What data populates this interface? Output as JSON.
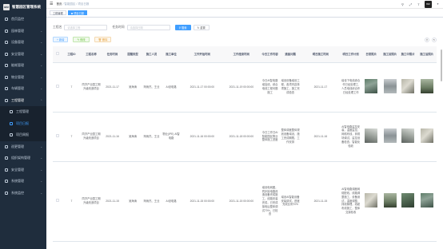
{
  "app": {
    "logo_mark": "BIM",
    "title": "智慧园区管理系统"
  },
  "sidebar": {
    "items": [
      {
        "label": "首页监控"
      },
      {
        "label": "园林管理"
      },
      {
        "label": "设备管理"
      },
      {
        "label": "安全管理"
      },
      {
        "label": "能耗管理"
      },
      {
        "label": "物业管理"
      },
      {
        "label": "车辆管理"
      },
      {
        "label": "工程管理"
      }
    ],
    "subitems": [
      {
        "label": "工程管理"
      },
      {
        "label": "项目日报"
      },
      {
        "label": "项目周报"
      }
    ],
    "items_after": [
      {
        "label": "巡更管理"
      },
      {
        "label": "组织架构管理"
      },
      {
        "label": "安全管理"
      },
      {
        "label": "系统管理"
      },
      {
        "label": "系统监控"
      }
    ]
  },
  "header": {
    "breadcrumb": [
      "首页",
      "智能园区",
      "项目日报"
    ],
    "avatar_text": "BIM"
  },
  "tags": [
    {
      "label": "工程管理"
    },
    {
      "label": "项目日报"
    }
  ],
  "search": {
    "project_label": "工程名",
    "project_placeholder": "请选择工程",
    "date_label": "任务时间",
    "date_placeholder": "请选择日期",
    "search_btn": "搜索",
    "reset_btn": "重置"
  },
  "actions": {
    "add": "新增",
    "edit": "修改",
    "delete": "删除"
  },
  "table": {
    "headers": [
      "工程ID",
      "工程名称",
      "任务时间",
      "提醒类型",
      "施工人员",
      "施工单位",
      "工作开始时间",
      "工作结束时间",
      "今日工作内容",
      "遗留问题",
      "明日施工时间",
      "明日工作计划",
      "日常照片",
      "施工前照片",
      "施工中照片",
      "施工后照片"
    ],
    "rows": [
      {
        "id": "7",
        "name": "同济产业园工期升级改造项目",
        "date": "2021-11-17",
        "type": "吴海涛",
        "workers": "阿雨杰、王业",
        "unit": "AI设电路",
        "start": "2021-11-17 00:00:00",
        "end": "2021-11-19 00:00:00",
        "content": "今日AI智电路增加线，综合电线工程问题施工",
        "issue": "增设设备增设工程，各项内容事项施工，施工完成检查",
        "next": "2021-11-17",
        "plan": "增设下电线综合作已经处理工, 人员电线综合作已经处理工作"
      },
      {
        "id": "7",
        "name": "同济产业园工期升级改造项目",
        "date": "2021-11-16",
        "type": "吴海涛",
        "workers": "阿雨杰、王业",
        "unit": "物业(IPE) AI智电路",
        "start": "2021-11-16 00:00:00",
        "end": "2021-11-18 00:00:00",
        "content": "今日工作日AI智能园区物业整体施工进度",
        "issue": "整体调度整体规划设备增设，施工完成期限，工作安排",
        "next": "2021-11-16",
        "plan": "AI智电路监控安装，温度监控，网络布线，到现场调试，监控设备检查，智能化验收"
      },
      {
        "id": "7",
        "name": "同济产业园工期升级改造项目",
        "date": "2021-11-15",
        "type": "吴海涛",
        "workers": "阿雨杰、王业",
        "unit": "AI设电路",
        "start": "2021-11-15 00:00:00",
        "end": "2021-11-15 00:00:00",
        "content": "增设电网图，同步接电路改造设备完成施工，线路安装完成，已完成接电后整体调试70%，已检查",
        "issue": "增设AI智能设备安装调试，进度完成比例70%",
        "next": "2021-11-15",
        "plan": "AI智电路调度网络配线，线路调整施工，设备测试，温度调整，排线管理，线缆布线施工，整体交接验收"
      }
    ]
  },
  "colors": {
    "sidebar_bg": "#1f2d3d",
    "accent": "#409eff",
    "selected_menu": "#409eff"
  }
}
